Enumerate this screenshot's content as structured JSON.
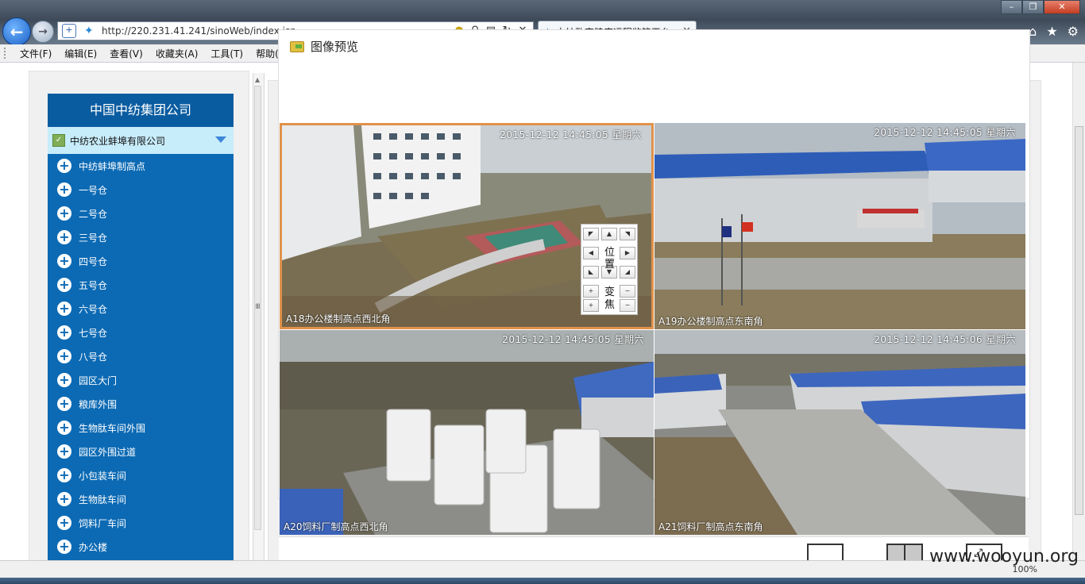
{
  "browser": {
    "url": "http://220.231.41.241/sinoWeb/index.jsp",
    "tab_title": "中纺数字粮库远程监管平台",
    "tab_close": "✕",
    "menu": [
      "文件(F)",
      "编辑(E)",
      "查看(V)",
      "收藏夹(A)",
      "工具(T)",
      "帮助(H)"
    ],
    "zoom": "100%"
  },
  "sidebar": {
    "title": "中国中纺集团公司",
    "company": "中纺农业蚌埠有限公司",
    "items": [
      "中纺蚌埠制高点",
      "一号仓",
      "二号仓",
      "三号仓",
      "四号仓",
      "五号仓",
      "六号仓",
      "七号仓",
      "八号仓",
      "园区大门",
      "粮库外围",
      "生物肽车间外围",
      "园区外围过道",
      "小包装车间",
      "生物肽车间",
      "饲料厂车间",
      "办公楼"
    ]
  },
  "preview": {
    "title": "图像预览",
    "cameras": [
      {
        "timestamp": "2015-12-12 14:45:05 星期六",
        "label": "A18办公楼制高点西北角"
      },
      {
        "timestamp": "2015-12-12 14:45:05 星期六",
        "label": "A19办公楼制高点东南角"
      },
      {
        "timestamp": "2015-12-12 14:45:05 星期六",
        "label": "A20饲料厂制高点西北角"
      },
      {
        "timestamp": "2015-12-12 14:45:06 星期六",
        "label": "A21饲料厂制高点东南角"
      }
    ],
    "ptz": {
      "position_label": "位置",
      "zoom_label": "变焦",
      "plus": "+",
      "minus": "−"
    }
  },
  "watermark": "www.wooyun.org",
  "colors": {
    "sidebar": "#0c6ab4",
    "selected_border": "#e0914a",
    "sub_header": "#c7ecfa"
  }
}
